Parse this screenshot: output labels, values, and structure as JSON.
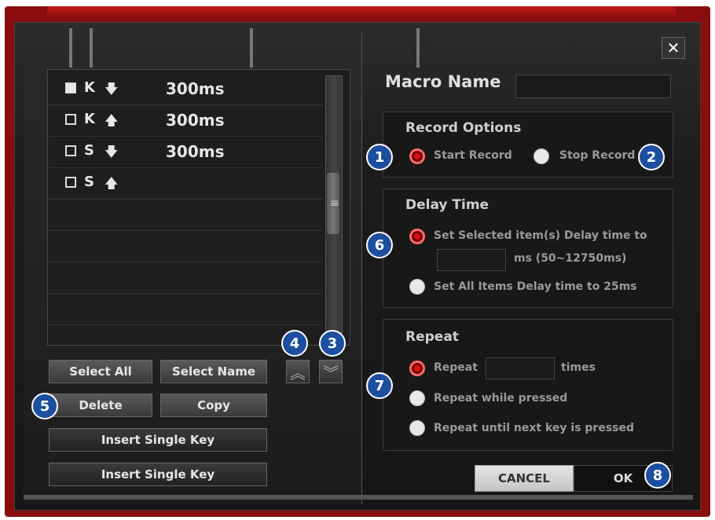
{
  "window": {
    "close_glyph": "✕",
    "macro_name_label": "Macro Name",
    "macro_name_value": ""
  },
  "macro_list": {
    "items": [
      {
        "checked": true,
        "key": "K",
        "direction": "down",
        "arrow": "🡇",
        "delay": "300ms"
      },
      {
        "checked": false,
        "key": "K",
        "direction": "up",
        "arrow": "🡅",
        "delay": "300ms"
      },
      {
        "checked": false,
        "key": "S",
        "direction": "down",
        "arrow": "🡇",
        "delay": "300ms"
      },
      {
        "checked": false,
        "key": "S",
        "direction": "up",
        "arrow": "🡅",
        "delay": ""
      }
    ],
    "scroll_grip": "≡"
  },
  "buttons": {
    "select_all": "Select All",
    "select_name": "Select Name",
    "delete": "Delete",
    "copy": "Copy",
    "insert_single_key_1": "Insert Single Key",
    "insert_single_key_2": "Insert Single Key",
    "move_up": "︽",
    "move_down": "︾",
    "cancel": "CANCEL",
    "ok": "OK"
  },
  "record_options": {
    "title": "Record Options",
    "start": "Start Record",
    "stop": "Stop Record",
    "selected": "start"
  },
  "delay_time": {
    "title": "Delay Time",
    "set_selected": "Set Selected item(s) Delay time to",
    "range": "ms (50~12750ms)",
    "value": "",
    "set_all": "Set All Items Delay time to 25ms",
    "selected": "set_selected"
  },
  "repeat": {
    "title": "Repeat",
    "repeat_label": "Repeat",
    "times_label": "times",
    "times_value": "",
    "while_pressed": "Repeat while pressed",
    "until_next": "Repeat until next key is pressed",
    "selected": "repeat"
  },
  "badges": [
    "1",
    "2",
    "3",
    "4",
    "5",
    "6",
    "7",
    "8"
  ],
  "colors": {
    "frame": "#8a0d0d",
    "radio_active": "#e01010",
    "badge": "#1d4fa0"
  }
}
